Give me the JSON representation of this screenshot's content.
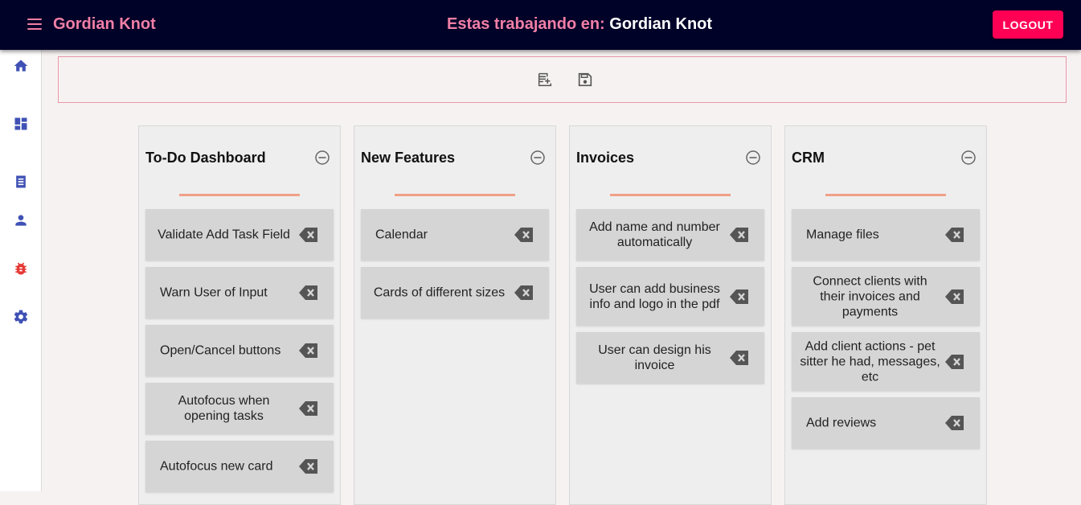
{
  "header": {
    "app_name": "Gordian Knot",
    "working_label": "Estas trabajando en:",
    "project_name": "Gordian Knot",
    "logout_label": "LOGOUT"
  },
  "sidebar": {
    "items": [
      {
        "icon": "home-icon"
      },
      {
        "icon": "dashboard-icon"
      },
      {
        "icon": "receipt-icon"
      },
      {
        "icon": "person-icon"
      },
      {
        "icon": "bug-icon"
      },
      {
        "icon": "gear-icon"
      }
    ]
  },
  "toolbar": {
    "buttons": [
      {
        "icon": "add-note-icon"
      },
      {
        "icon": "save-icon"
      }
    ]
  },
  "colors": {
    "topbar": "#010228",
    "accent_pink": "#f17fa6",
    "logout": "#ff0055",
    "sidebar_icon": "#3f51b5",
    "bug_icon": "#e53935",
    "divider": "#f0a088"
  },
  "columns": [
    {
      "title": "To-Do Dashboard",
      "cards": [
        {
          "text": "Validate Add Task Field"
        },
        {
          "text": "Warn User of Input"
        },
        {
          "text": "Open/Cancel buttons"
        },
        {
          "text": "Autofocus when opening tasks"
        },
        {
          "text": "Autofocus new card"
        }
      ]
    },
    {
      "title": "New Features",
      "cards": [
        {
          "text": "Calendar"
        },
        {
          "text": "Cards of different sizes"
        }
      ]
    },
    {
      "title": "Invoices",
      "cards": [
        {
          "text": "Add name and number automatically"
        },
        {
          "text": "User can add business info and logo in the pdf"
        },
        {
          "text": "User can design his invoice"
        }
      ]
    },
    {
      "title": "CRM",
      "cards": [
        {
          "text": "Manage files"
        },
        {
          "text": "Connect clients with their invoices and payments"
        },
        {
          "text": "Add client actions - pet sitter he had, messages, etc"
        },
        {
          "text": "Add reviews"
        }
      ]
    }
  ]
}
